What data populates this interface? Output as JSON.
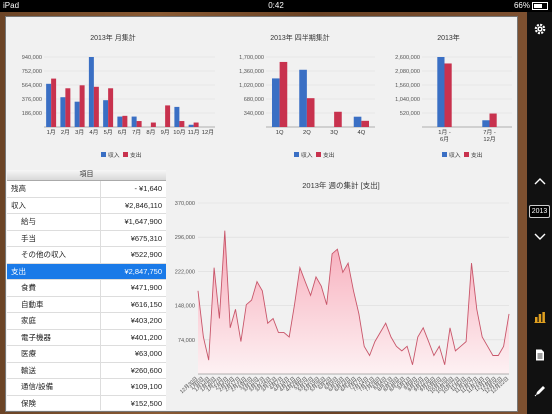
{
  "status": {
    "device": "iPad",
    "time": "0:42",
    "battery": "66%"
  },
  "colors": {
    "income": "#3a6fc4",
    "expense": "#c8324e",
    "selected": "#1a7ae8",
    "line": "#c8566a"
  },
  "legend": {
    "income": "収入",
    "expense": "支出"
  },
  "chart_data": [
    {
      "type": "bar",
      "title": "2013年 月集計",
      "categories": [
        "1月",
        "2月",
        "3月",
        "4月",
        "5月",
        "6月",
        "7月",
        "8月",
        "9月",
        "10月",
        "11月",
        "12月"
      ],
      "y_ticks": [
        "940,000",
        "752,000",
        "564,000",
        "376,000",
        "186,000"
      ],
      "ylim": [
        0,
        940000
      ],
      "series": [
        {
          "name": "収入",
          "values": [
            580000,
            400000,
            340000,
            940000,
            360000,
            140000,
            140000,
            0,
            0,
            270000,
            30000,
            0
          ]
        },
        {
          "name": "支出",
          "values": [
            650000,
            520000,
            560000,
            540000,
            520000,
            150000,
            80000,
            60000,
            290000,
            80000,
            60000,
            0
          ]
        }
      ]
    },
    {
      "type": "bar",
      "title": "2013年 四半期集計",
      "categories": [
        "1Q",
        "2Q",
        "3Q",
        "4Q"
      ],
      "y_ticks": [
        "1,700,000",
        "1,360,000",
        "1,020,000",
        "680,000",
        "340,000"
      ],
      "ylim": [
        0,
        1700000
      ],
      "series": [
        {
          "name": "収入",
          "values": [
            1180000,
            1390000,
            0,
            250000
          ]
        },
        {
          "name": "支出",
          "values": [
            1580000,
            700000,
            370000,
            150000
          ]
        }
      ]
    },
    {
      "type": "bar",
      "title": "2013年",
      "categories": [
        "1月 - 6月",
        "7月 - 12月"
      ],
      "y_ticks": [
        "2,600,000",
        "2,080,000",
        "1,560,000",
        "1,040,000",
        "520,000"
      ],
      "ylim": [
        0,
        2600000
      ],
      "series": [
        {
          "name": "収入",
          "values": [
            2600000,
            250000
          ]
        },
        {
          "name": "支出",
          "values": [
            2360000,
            500000
          ]
        }
      ]
    },
    {
      "type": "area",
      "title": "2013年 週の集計 [支出]",
      "y_ticks": [
        "370,000",
        "296,000",
        "222,000",
        "148,000",
        "74,000"
      ],
      "ylim": [
        0,
        370000
      ],
      "x": [
        "12月30日",
        "1月6日",
        "1月13日",
        "1月20日",
        "1月27日",
        "2月3日",
        "2月10日",
        "2月17日",
        "2月24日",
        "3月3日",
        "3月10日",
        "3月17日",
        "3月24日",
        "3月31日",
        "4月7日",
        "4月14日",
        "4月21日",
        "4月28日",
        "5月5日",
        "5月12日",
        "5月19日",
        "5月26日",
        "6月2日",
        "6月9日",
        "6月16日",
        "6月23日",
        "6月30日",
        "7月7日",
        "7月14日",
        "7月21日",
        "7月28日",
        "8月4日",
        "8月11日",
        "8月18日",
        "8月25日",
        "9月1日",
        "9月8日",
        "9月15日",
        "9月22日",
        "9月29日",
        "10月6日",
        "10月13日",
        "10月20日",
        "10月27日",
        "11月3日",
        "11月10日",
        "11月17日",
        "11月24日",
        "12月1日",
        "12月8日",
        "12月15日",
        "12月22日"
      ],
      "values": [
        180000,
        80000,
        30000,
        230000,
        120000,
        310000,
        100000,
        140000,
        70000,
        150000,
        160000,
        200000,
        180000,
        110000,
        120000,
        90000,
        90000,
        80000,
        150000,
        230000,
        200000,
        170000,
        210000,
        190000,
        150000,
        260000,
        270000,
        220000,
        240000,
        180000,
        130000,
        60000,
        40000,
        70000,
        90000,
        110000,
        80000,
        60000,
        50000,
        60000,
        20000,
        80000,
        100000,
        70000,
        40000,
        60000,
        20000,
        100000,
        50000,
        60000,
        70000,
        240000,
        140000,
        80000,
        60000,
        40000,
        40000,
        60000,
        130000
      ]
    }
  ],
  "table": {
    "header": "項目",
    "rows": [
      {
        "label": "残高",
        "value": "- ¥1,640",
        "indent": 0,
        "selected": false
      },
      {
        "label": "収入",
        "value": "¥2,846,110",
        "indent": 0,
        "selected": false
      },
      {
        "label": "給与",
        "value": "¥1,647,900",
        "indent": 1,
        "selected": false
      },
      {
        "label": "手当",
        "value": "¥675,310",
        "indent": 1,
        "selected": false
      },
      {
        "label": "その他の収入",
        "value": "¥522,900",
        "indent": 1,
        "selected": false
      },
      {
        "label": "支出",
        "value": "¥2,847,750",
        "indent": 0,
        "selected": true
      },
      {
        "label": "食費",
        "value": "¥471,900",
        "indent": 1,
        "selected": false
      },
      {
        "label": "自動車",
        "value": "¥616,150",
        "indent": 1,
        "selected": false
      },
      {
        "label": "家庭",
        "value": "¥403,200",
        "indent": 1,
        "selected": false
      },
      {
        "label": "電子機器",
        "value": "¥401,200",
        "indent": 1,
        "selected": false
      },
      {
        "label": "医療",
        "value": "¥63,000",
        "indent": 1,
        "selected": false
      },
      {
        "label": "輸送",
        "value": "¥260,600",
        "indent": 1,
        "selected": false
      },
      {
        "label": "通信/設備",
        "value": "¥109,100",
        "indent": 1,
        "selected": false
      },
      {
        "label": "保険",
        "value": "¥152,500",
        "indent": 1,
        "selected": false
      }
    ]
  },
  "sidebar": {
    "settings_icon": "gear-icon",
    "up_icon": "chevron-up-icon",
    "year": "2013",
    "down_icon": "chevron-down-icon",
    "chart_icon": "bar-chart-icon",
    "doc_icon": "document-icon",
    "edit_icon": "pencil-icon"
  }
}
